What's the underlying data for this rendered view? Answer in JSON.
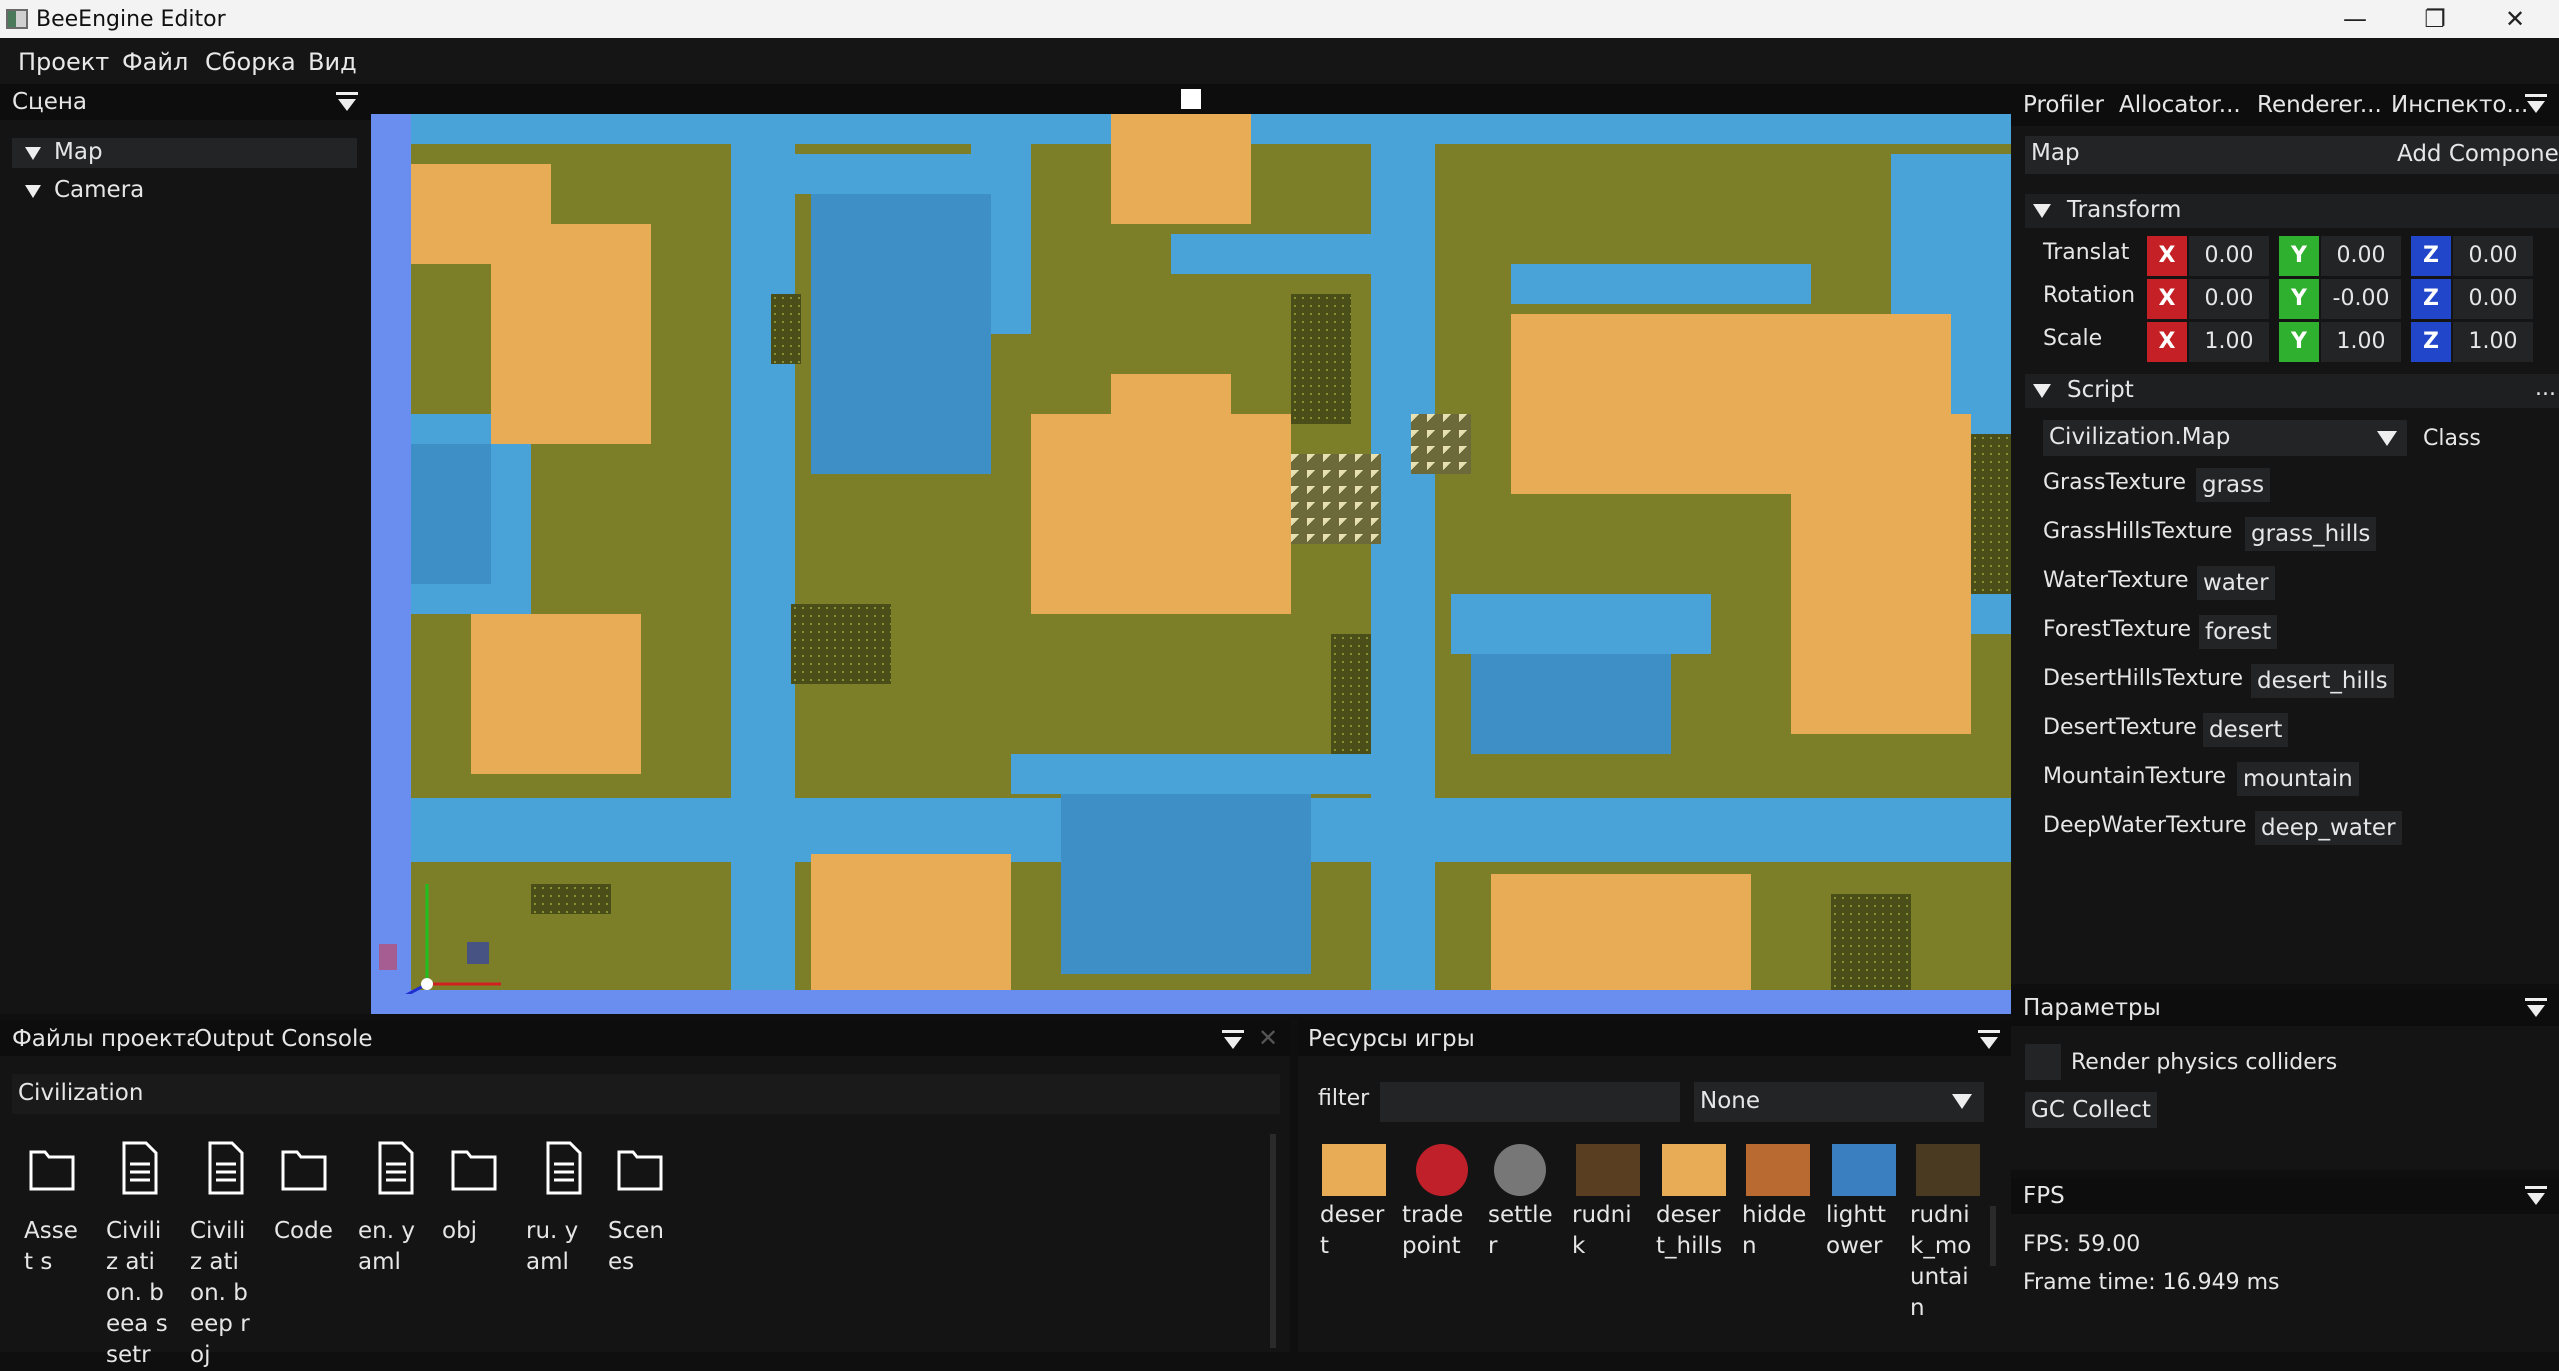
{
  "window": {
    "title": "BeeEngine Editor",
    "minimize": "—",
    "restore": "❐",
    "close": "✕"
  },
  "menu": {
    "items": [
      "Проект",
      "Файл",
      "Сборка",
      "Вид"
    ]
  },
  "scene_panel": {
    "title": "Сцена",
    "items": [
      "Map",
      "Camera"
    ]
  },
  "right_tabs": [
    "Profiler",
    "Allocator...",
    "Renderer...",
    "Инспекто..."
  ],
  "inspector": {
    "entity_name": "Map",
    "add_component": "Add Component",
    "transform": {
      "title": "Transform",
      "rows": [
        {
          "label": "Translat",
          "x": "0.00",
          "y": "0.00",
          "z": "0.00"
        },
        {
          "label": "Rotation",
          "x": "0.00",
          "y": "-0.00",
          "z": "0.00"
        },
        {
          "label": "Scale",
          "x": "1.00",
          "y": "1.00",
          "z": "1.00"
        }
      ],
      "axis_x": "X",
      "axis_y": "Y",
      "axis_z": "Z"
    },
    "script": {
      "title": "Script",
      "more": "...",
      "class_value": "Civilization.Map",
      "class_label": "Class",
      "fields": [
        {
          "name": "GrassTexture",
          "value": "grass"
        },
        {
          "name": "GrassHillsTexture",
          "value": "grass_hills"
        },
        {
          "name": "WaterTexture",
          "value": "water"
        },
        {
          "name": "ForestTexture",
          "value": "forest"
        },
        {
          "name": "DesertHillsTexture",
          "value": "desert_hills"
        },
        {
          "name": "DesertTexture",
          "value": "desert"
        },
        {
          "name": "MountainTexture",
          "value": "mountain"
        },
        {
          "name": "DeepWaterTexture",
          "value": "deep_water"
        }
      ]
    }
  },
  "params_panel": {
    "title": "Параметры",
    "checkbox_label": "Render physics colliders",
    "gc_button": "GC Collect"
  },
  "fps_panel": {
    "title": "FPS",
    "fps": "FPS: 59.00",
    "frame_time": "Frame time: 16.949 ms"
  },
  "project_panel": {
    "tabs": [
      "Файлы проекта",
      "Output Console"
    ],
    "path": "Civilization",
    "items": [
      {
        "type": "folder",
        "label": "Asset s"
      },
      {
        "type": "file",
        "label": "Civiliz ation. beea ssetr"
      },
      {
        "type": "file",
        "label": "Civiliz ation. beep roj"
      },
      {
        "type": "folder",
        "label": "Code"
      },
      {
        "type": "file",
        "label": "en. yaml"
      },
      {
        "type": "folder",
        "label": "obj"
      },
      {
        "type": "file",
        "label": "ru. yaml"
      },
      {
        "type": "folder",
        "label": "Scen es"
      }
    ]
  },
  "resources_panel": {
    "title": "Ресурсы игры",
    "filter_label": "filter",
    "filter_value": "",
    "type_select": "None",
    "items": [
      {
        "label": "deser t",
        "color": "#e7ac55"
      },
      {
        "label": "trade point",
        "color": "#c0202a"
      },
      {
        "label": "settle r",
        "color": "#777777"
      },
      {
        "label": "rudni k",
        "color": "#5a3e22"
      },
      {
        "label": "deser t_hills",
        "color": "#e7ac55"
      },
      {
        "label": "hidde n",
        "color": "#b86a30"
      },
      {
        "label": "lightt ower",
        "color": "#3a7fc0"
      },
      {
        "label": "rudni k_mo untai n",
        "color": "#4a3a22"
      }
    ]
  }
}
